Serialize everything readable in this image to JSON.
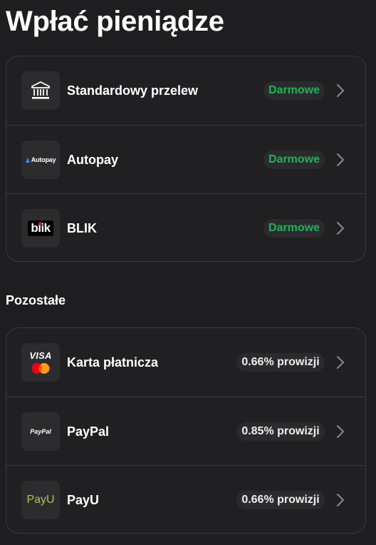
{
  "header": {
    "title": "Wpłać pieniądze"
  },
  "main_methods": [
    {
      "label": "Standardowy przelew",
      "icon": "bank-icon",
      "badge": "Darmowe"
    },
    {
      "label": "Autopay",
      "icon": "autopay-logo",
      "icon_text": "Autopay",
      "badge": "Darmowe"
    },
    {
      "label": "BLIK",
      "icon": "blik-logo",
      "icon_text": "blik",
      "badge": "Darmowe"
    }
  ],
  "other_section": {
    "title": "Pozostałe",
    "methods": [
      {
        "label": "Karta płatnicza",
        "icon": "visa-mastercard-logo",
        "icon_text": "VISA",
        "badge": "0.66% prowizji"
      },
      {
        "label": "PayPal",
        "icon": "paypal-logo",
        "icon_text": "PayPal",
        "badge": "0.85% prowizji"
      },
      {
        "label": "PayU",
        "icon": "payu-logo",
        "icon_text": "PayU",
        "badge": "0.66% prowizji"
      }
    ]
  },
  "colors": {
    "background": "#1e1e20",
    "card_border": "#3a3a3d",
    "free_badge_text": "#22b158",
    "fee_badge_text": "#eeeeee",
    "chevron": "#8a8a8e"
  }
}
